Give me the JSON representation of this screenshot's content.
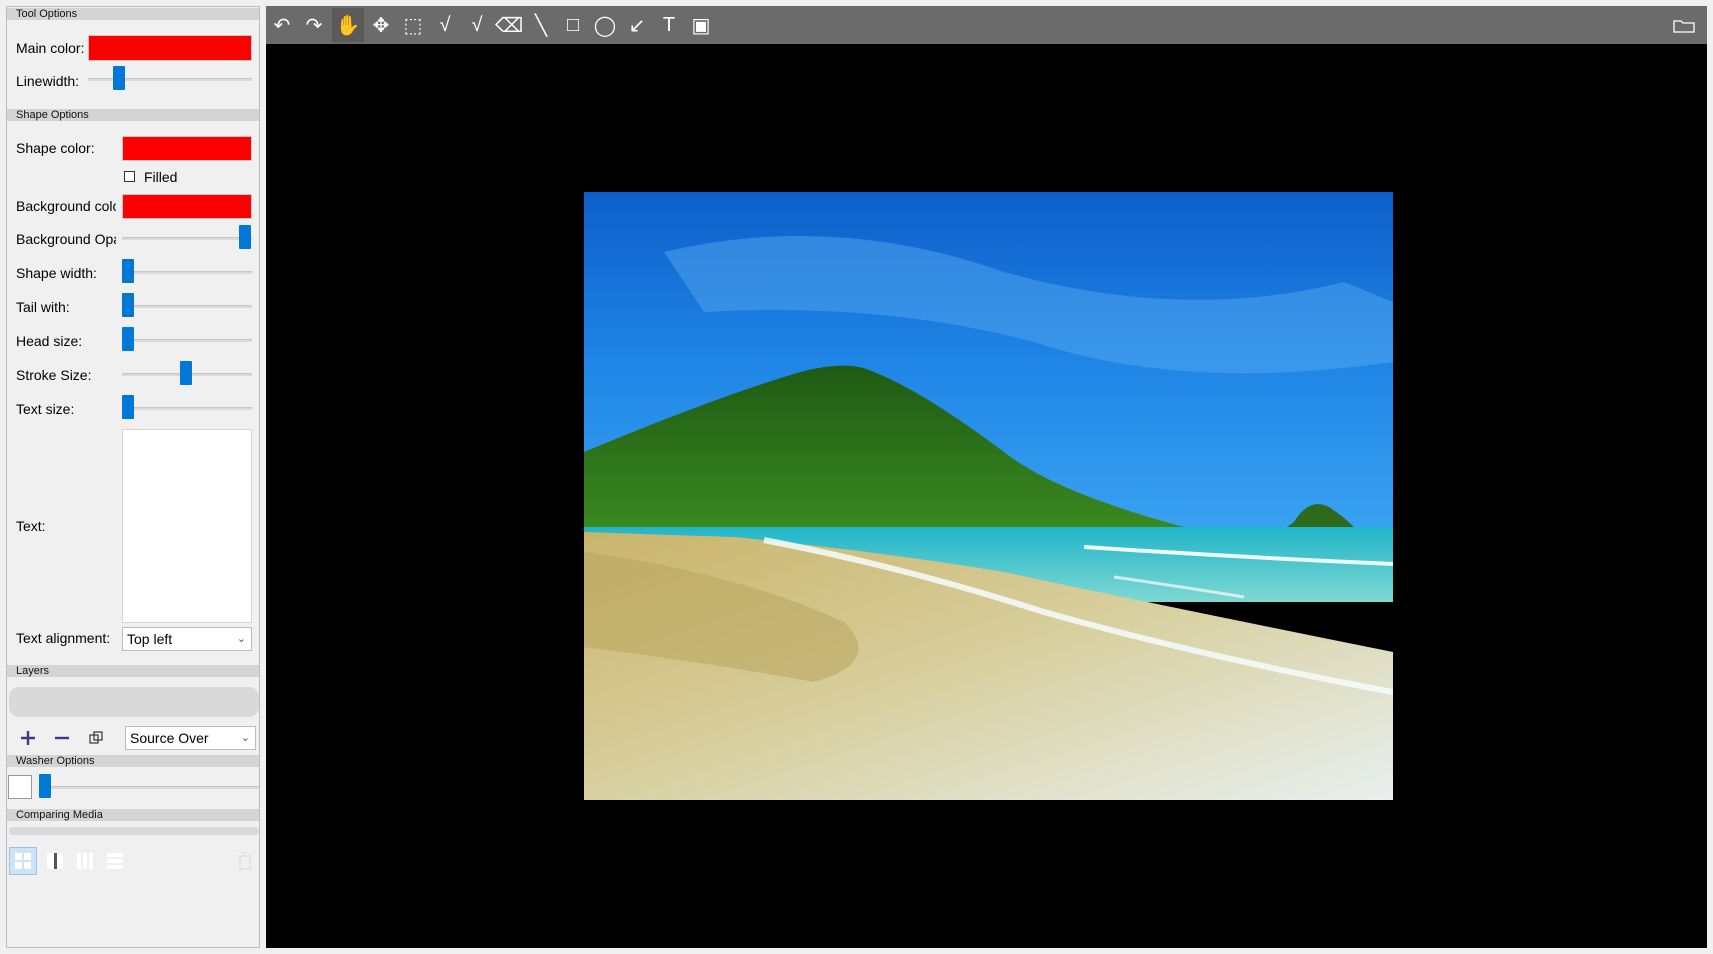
{
  "tool_options": {
    "header": "Tool Options",
    "main_color_label": "Main color:",
    "main_color": "#ff0000",
    "linewidth_label": "Linewidth:",
    "linewidth_value": 0.2
  },
  "shape_options": {
    "header": "Shape Options",
    "shape_color_label": "Shape color:",
    "shape_color": "#ff0000",
    "filled_label": "Filled",
    "filled_checked": false,
    "background_color_label": "Background colc",
    "background_color": "#ff0000",
    "background_opacity_label": "Background Opa",
    "background_opacity_value": 1.0,
    "shape_width_label": "Shape width:",
    "tail_width_label": "Tail with:",
    "head_size_label": "Head size:",
    "stroke_size_label": "Stroke Size:",
    "stroke_size_value": 0.5,
    "text_size_label": "Text size:",
    "text_label": "Text:",
    "text_value": "",
    "text_alignment_label": "Text alignment:",
    "text_alignment_value": "Top left"
  },
  "layers": {
    "header": "Layers",
    "blend_mode": "Source Over"
  },
  "washer_options": {
    "header": "Washer Options",
    "washer_value": 0.0
  },
  "comparing_media": {
    "header": "Comparing Media"
  },
  "toolbar": {
    "tools": [
      {
        "name": "undo-icon",
        "glyph": "↶"
      },
      {
        "name": "redo-icon",
        "glyph": "↷"
      },
      {
        "name": "hand-pan-icon",
        "glyph": "✋"
      },
      {
        "name": "move-icon",
        "glyph": "✥"
      },
      {
        "name": "rectangle-select-icon",
        "glyph": "⬚"
      },
      {
        "name": "pen-icon",
        "glyph": "√"
      },
      {
        "name": "brush-icon",
        "glyph": "√"
      },
      {
        "name": "eraser-icon",
        "glyph": "⌫"
      },
      {
        "name": "line-icon",
        "glyph": "╲"
      },
      {
        "name": "rectangle-icon",
        "glyph": "□"
      },
      {
        "name": "ellipse-icon",
        "glyph": "◯"
      },
      {
        "name": "arrow-icon",
        "glyph": "↙"
      },
      {
        "name": "text-icon",
        "glyph": "T"
      },
      {
        "name": "image-icon",
        "glyph": "▣"
      }
    ],
    "active_tool": "hand-pan-icon",
    "folder_icon": "folder-icon"
  }
}
